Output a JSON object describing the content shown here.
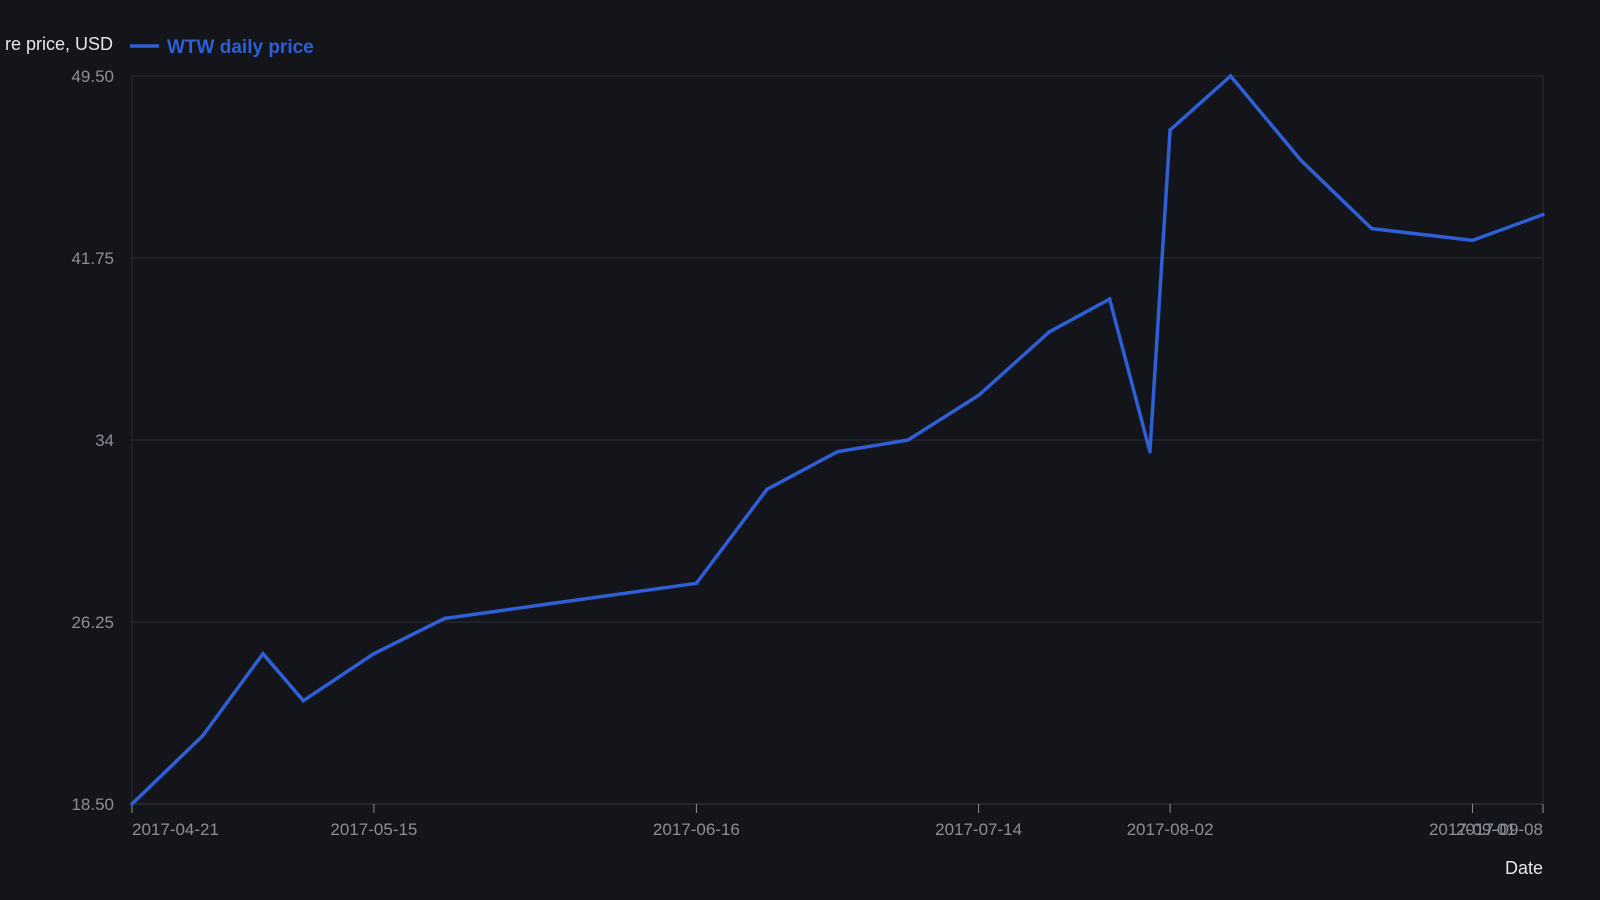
{
  "chart_data": {
    "type": "line",
    "ylabel": "re price, USD",
    "xlabel": "Date",
    "ylim": [
      18.5,
      49.5
    ],
    "y_ticks": [
      "18.50",
      "26.25",
      "34",
      "41.75",
      "49.50"
    ],
    "x_range": [
      "2017-04-21",
      "2017-09-08"
    ],
    "x_ticks": [
      "2017-04-21",
      "2017-05-15",
      "2017-06-16",
      "2017-07-14",
      "2017-08-02",
      "2017-09-01",
      "2017-09-08"
    ],
    "grid": true,
    "legend_position": "top-left",
    "series": [
      {
        "name": "WTW daily price",
        "color": "#2e5fd6",
        "x": [
          "2017-04-21",
          "2017-04-28",
          "2017-05-04",
          "2017-05-08",
          "2017-05-15",
          "2017-05-22",
          "2017-06-01",
          "2017-06-16",
          "2017-06-23",
          "2017-06-30",
          "2017-07-07",
          "2017-07-14",
          "2017-07-21",
          "2017-07-27",
          "2017-07-31",
          "2017-08-02",
          "2017-08-08",
          "2017-08-15",
          "2017-08-22",
          "2017-09-01",
          "2017-09-08"
        ],
        "values": [
          18.5,
          21.4,
          24.9,
          22.9,
          24.9,
          26.4,
          27.0,
          27.9,
          31.9,
          33.5,
          34.0,
          35.9,
          38.6,
          40.0,
          33.5,
          47.2,
          49.5,
          45.9,
          43.0,
          42.5,
          43.6
        ]
      }
    ]
  }
}
